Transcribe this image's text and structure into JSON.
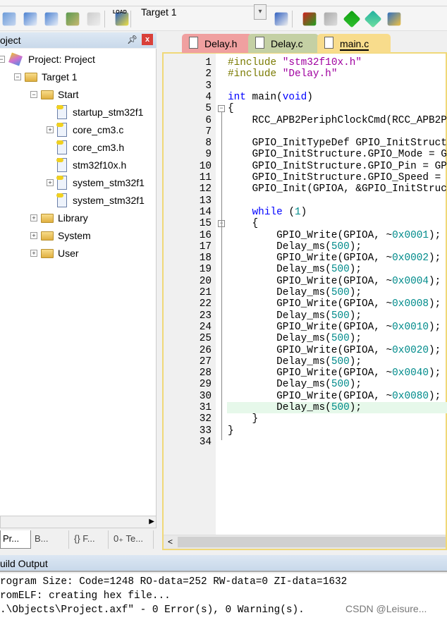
{
  "toolbar": {
    "target": "Target 1",
    "icons": [
      "batch-build-icon",
      "build-icon",
      "rebuild-icon",
      "stack-icon",
      "stop-build-icon",
      "load-icon",
      "magic-wand-icon",
      "components-icon",
      "windows-icon",
      "diamond-icon",
      "funnel-icon",
      "packs-icon"
    ],
    "load_label": "LOAD"
  },
  "project": {
    "title": "oject",
    "pin": "ᵠ",
    "close": "x",
    "tree": [
      {
        "label": "Project: Project",
        "level": 0,
        "exp": "-",
        "icon": "project"
      },
      {
        "label": "Target 1",
        "level": 1,
        "exp": "-",
        "icon": "folder"
      },
      {
        "label": "Start",
        "level": 2,
        "exp": "-",
        "icon": "folder"
      },
      {
        "label": "startup_stm32f1",
        "level": 3,
        "exp": "",
        "icon": "file"
      },
      {
        "label": "core_cm3.c",
        "level": 3,
        "exp": "+",
        "icon": "file"
      },
      {
        "label": "core_cm3.h",
        "level": 3,
        "exp": "",
        "icon": "file"
      },
      {
        "label": "stm32f10x.h",
        "level": 3,
        "exp": "",
        "icon": "file"
      },
      {
        "label": "system_stm32f1",
        "level": 3,
        "exp": "+",
        "icon": "file"
      },
      {
        "label": "system_stm32f1",
        "level": 3,
        "exp": "",
        "icon": "file"
      },
      {
        "label": "Library",
        "level": 2,
        "exp": "+",
        "icon": "folder"
      },
      {
        "label": "System",
        "level": 2,
        "exp": "+",
        "icon": "folder"
      },
      {
        "label": "User",
        "level": 2,
        "exp": "+",
        "icon": "folder"
      }
    ],
    "tabs": [
      "Pr...",
      "B...",
      "{} F...",
      "0₊ Te..."
    ]
  },
  "editor": {
    "tabs": [
      {
        "label": "Delay.h",
        "color": "#f0a0a0"
      },
      {
        "label": "Delay.c",
        "color": "#c4d0a4"
      },
      {
        "label": "main.c",
        "color": "#f8dc8c",
        "active": true
      }
    ],
    "current_line": 31,
    "lines": [
      [
        [
          "p",
          "#include "
        ],
        [
          "s",
          "\"stm32f10x.h\""
        ]
      ],
      [
        [
          "p",
          "#include "
        ],
        [
          "s",
          "\"Delay.h\""
        ]
      ],
      [],
      [
        [
          "k",
          "int"
        ],
        [
          "t",
          " main("
        ],
        [
          "k",
          "void"
        ],
        [
          "t",
          ")"
        ]
      ],
      [
        [
          "t",
          "{"
        ]
      ],
      [
        [
          "t",
          "    RCC_APB2PeriphClockCmd(RCC_APB2P"
        ]
      ],
      [],
      [
        [
          "t",
          "    GPIO_InitTypeDef GPIO_InitStruct"
        ]
      ],
      [
        [
          "t",
          "    GPIO_InitStructure.GPIO_Mode = G"
        ]
      ],
      [
        [
          "t",
          "    GPIO_InitStructure.GPIO_Pin = GP"
        ]
      ],
      [
        [
          "t",
          "    GPIO_InitStructure.GPIO_Speed = "
        ]
      ],
      [
        [
          "t",
          "    GPIO_Init(GPIOA, &GPIO_InitStruc"
        ]
      ],
      [],
      [
        [
          "t",
          "    "
        ],
        [
          "k",
          "while"
        ],
        [
          "t",
          " ("
        ],
        [
          "n",
          "1"
        ],
        [
          "t",
          ")"
        ]
      ],
      [
        [
          "t",
          "    {"
        ]
      ],
      [
        [
          "t",
          "        GPIO_Write(GPIOA, ~"
        ],
        [
          "n",
          "0x0001"
        ],
        [
          "t",
          ");"
        ]
      ],
      [
        [
          "t",
          "        Delay_ms("
        ],
        [
          "n",
          "500"
        ],
        [
          "t",
          ");"
        ]
      ],
      [
        [
          "t",
          "        GPIO_Write(GPIOA, ~"
        ],
        [
          "n",
          "0x0002"
        ],
        [
          "t",
          ");"
        ]
      ],
      [
        [
          "t",
          "        Delay_ms("
        ],
        [
          "n",
          "500"
        ],
        [
          "t",
          ");"
        ]
      ],
      [
        [
          "t",
          "        GPIO_Write(GPIOA, ~"
        ],
        [
          "n",
          "0x0004"
        ],
        [
          "t",
          ");"
        ]
      ],
      [
        [
          "t",
          "        Delay_ms("
        ],
        [
          "n",
          "500"
        ],
        [
          "t",
          ");"
        ]
      ],
      [
        [
          "t",
          "        GPIO_Write(GPIOA, ~"
        ],
        [
          "n",
          "0x0008"
        ],
        [
          "t",
          ");"
        ]
      ],
      [
        [
          "t",
          "        Delay_ms("
        ],
        [
          "n",
          "500"
        ],
        [
          "t",
          ");"
        ]
      ],
      [
        [
          "t",
          "        GPIO_Write(GPIOA, ~"
        ],
        [
          "n",
          "0x0010"
        ],
        [
          "t",
          ");"
        ]
      ],
      [
        [
          "t",
          "        Delay_ms("
        ],
        [
          "n",
          "500"
        ],
        [
          "t",
          ");"
        ]
      ],
      [
        [
          "t",
          "        GPIO_Write(GPIOA, ~"
        ],
        [
          "n",
          "0x0020"
        ],
        [
          "t",
          ");"
        ]
      ],
      [
        [
          "t",
          "        Delay_ms("
        ],
        [
          "n",
          "500"
        ],
        [
          "t",
          ");"
        ]
      ],
      [
        [
          "t",
          "        GPIO_Write(GPIOA, ~"
        ],
        [
          "n",
          "0x0040"
        ],
        [
          "t",
          ");"
        ]
      ],
      [
        [
          "t",
          "        Delay_ms("
        ],
        [
          "n",
          "500"
        ],
        [
          "t",
          ");"
        ]
      ],
      [
        [
          "t",
          "        GPIO_Write(GPIOA, ~"
        ],
        [
          "n",
          "0x0080"
        ],
        [
          "t",
          ");"
        ]
      ],
      [
        [
          "t",
          "        Delay_ms("
        ],
        [
          "n",
          "500"
        ],
        [
          "t",
          ");"
        ]
      ],
      [
        [
          "t",
          "    }"
        ]
      ],
      [
        [
          "t",
          "}"
        ]
      ],
      []
    ]
  },
  "build_output": {
    "title": "uild Output",
    "lines": [
      "rogram Size: Code=1248 RO-data=252 RW-data=0 ZI-data=1632",
      "romELF: creating hex file...",
      ".\\Objects\\Project.axf\" - 0 Error(s), 0 Warning(s)."
    ]
  },
  "watermark": "CSDN @Leisure..."
}
